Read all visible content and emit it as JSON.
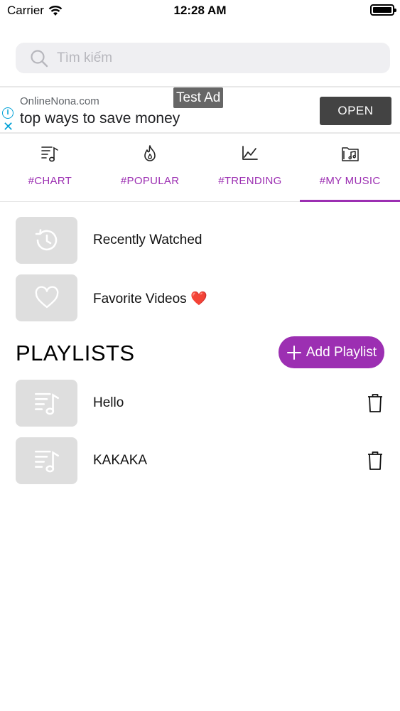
{
  "status_bar": {
    "carrier": "Carrier",
    "time": "12:28 AM"
  },
  "search": {
    "placeholder": "Tìm kiếm",
    "value": ""
  },
  "ad": {
    "tag": "Test Ad",
    "domain": "OnlineNona.com",
    "headline": "top ways to save money",
    "cta": "OPEN",
    "info_glyph": "i",
    "close_glyph": "✕"
  },
  "tabs": [
    {
      "label": "#CHART",
      "icon": "playlist-music-icon",
      "active": false
    },
    {
      "label": "#POPULAR",
      "icon": "flame-icon",
      "active": false
    },
    {
      "label": "#TRENDING",
      "icon": "trending-chart-icon",
      "active": false
    },
    {
      "label": "#MY MUSIC",
      "icon": "music-folder-icon",
      "active": true
    }
  ],
  "library": {
    "items": [
      {
        "label": "Recently Watched",
        "icon": "history-icon"
      },
      {
        "label": "Favorite Videos ❤️",
        "icon": "heart-icon"
      }
    ]
  },
  "playlists": {
    "title": "PLAYLISTS",
    "add_label": "Add Playlist",
    "items": [
      {
        "name": "Hello",
        "icon": "playlist-music-icon"
      },
      {
        "name": "KAKAKA",
        "icon": "playlist-music-icon"
      }
    ]
  },
  "colors": {
    "accent": "#9c2fb2",
    "thumb_bg": "#dedede",
    "search_bg": "#efeff2",
    "ad_button": "#434343"
  }
}
